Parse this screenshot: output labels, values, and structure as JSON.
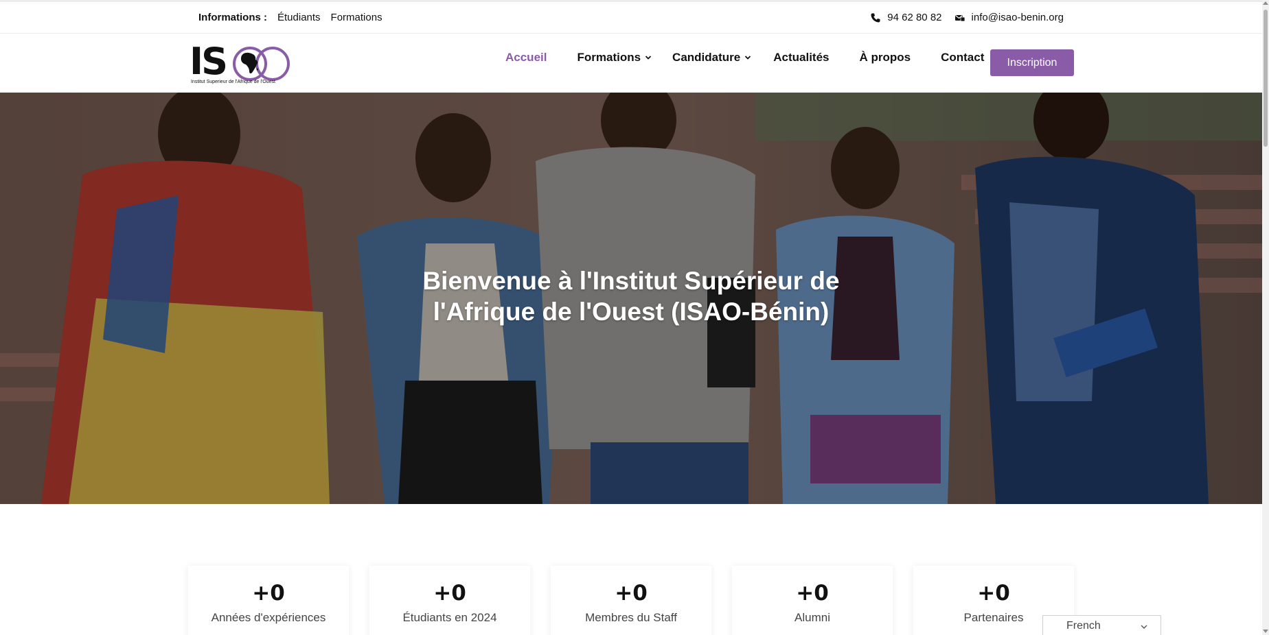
{
  "topbar": {
    "info_label": "Informations :",
    "links": [
      "Étudiants",
      "Formations"
    ],
    "phone": "94 62 80 82",
    "email": "info@isao-benin.org"
  },
  "logo": {
    "text": "ISAO",
    "tagline": "Institut Superieur de l'Afrique de l'Ouest"
  },
  "nav": {
    "items": [
      {
        "label": "Accueil",
        "active": true
      },
      {
        "label": "Formations",
        "dropdown": true
      },
      {
        "label": "Candidature",
        "dropdown": true
      },
      {
        "label": "Actualités"
      },
      {
        "label": "À propos"
      },
      {
        "label": "Contact"
      }
    ],
    "cta": "Inscription"
  },
  "hero": {
    "title_line1": "Bienvenue à l'Institut Supérieur de",
    "title_line2": "l'Afrique de l'Ouest (ISAO-Bénin)"
  },
  "stats": [
    {
      "value": "+0",
      "label": "Années d'expériences"
    },
    {
      "value": "+0",
      "label": "Étudiants en 2024"
    },
    {
      "value": "+0",
      "label": "Membres du Staff"
    },
    {
      "value": "+0",
      "label": "Alumni"
    },
    {
      "value": "+0",
      "label": "Partenaires"
    }
  ],
  "language": {
    "selected": "French"
  },
  "colors": {
    "accent": "#8a5ca8",
    "text": "#111111"
  },
  "icons": [
    "phone-icon",
    "mail-icon",
    "chevron-down-icon",
    "africa-map-icon"
  ]
}
